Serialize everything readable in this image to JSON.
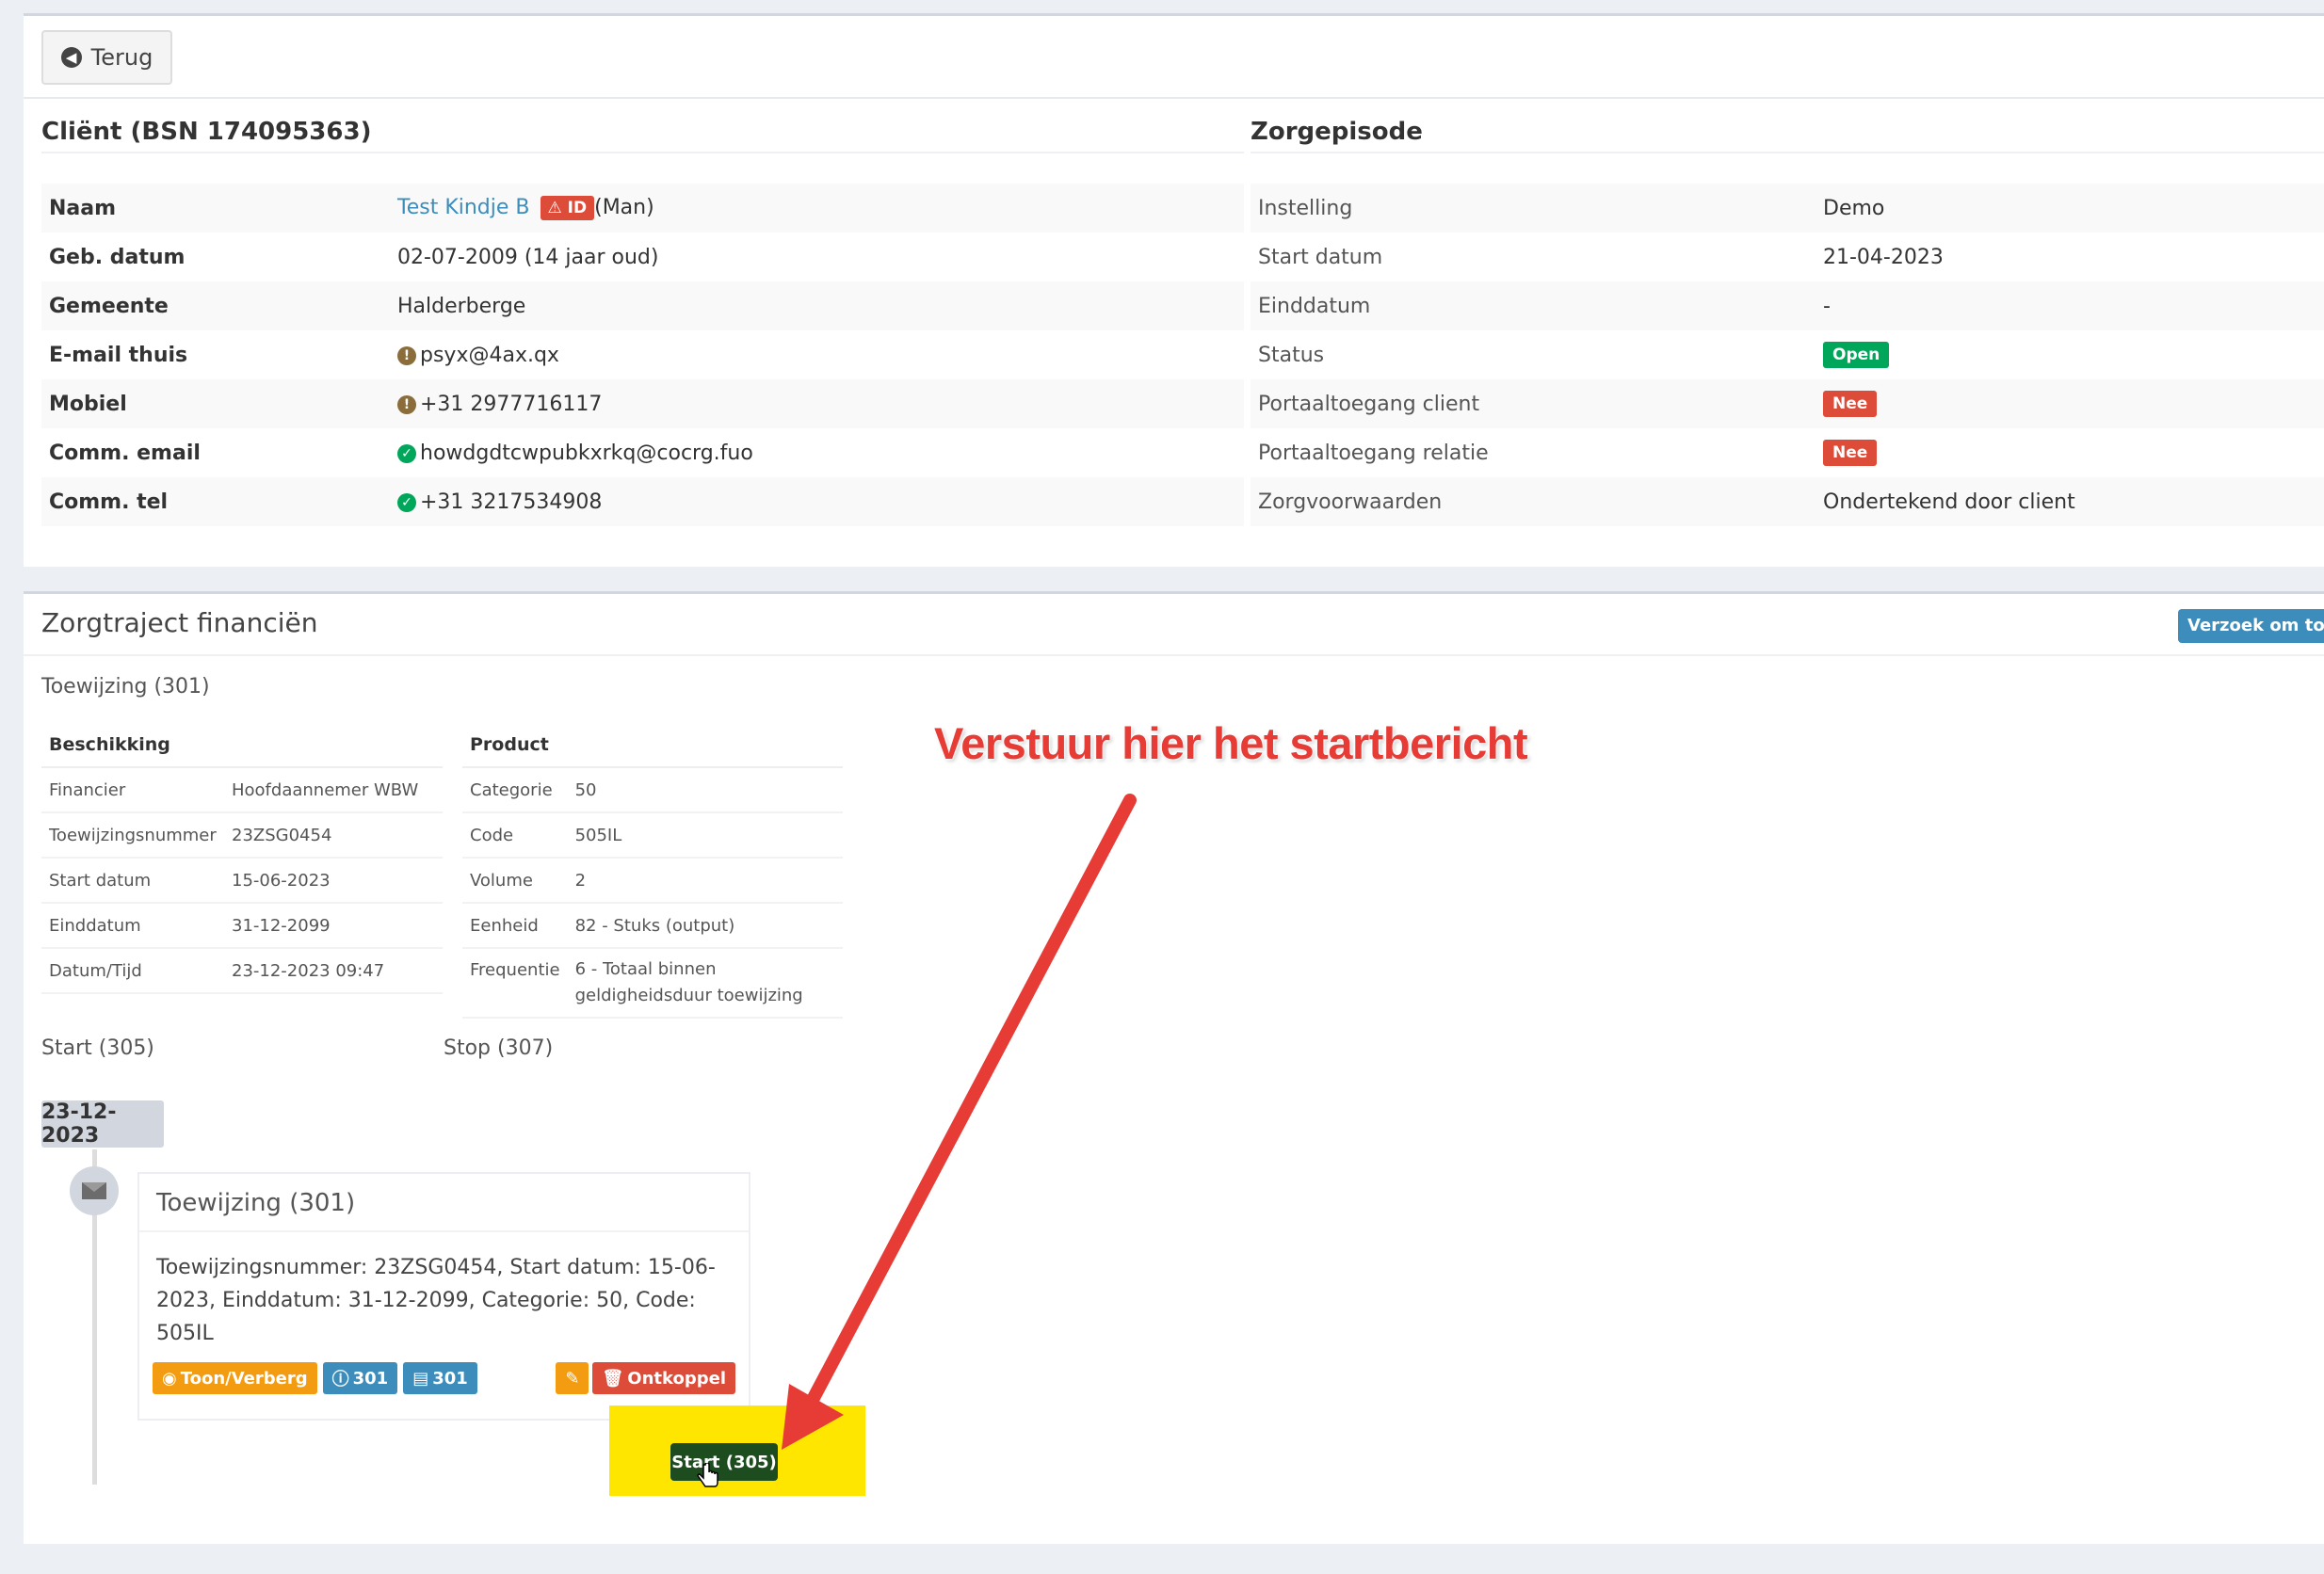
{
  "back_button": {
    "label": "Terug"
  },
  "client": {
    "title": "Cliënt (BSN 174095363)",
    "rows": [
      {
        "label": "Naam",
        "name": "Test Kindje B",
        "id_badge": "ID",
        "suffix": "(Man)"
      },
      {
        "label": "Geb. datum",
        "value": "02-07-2009 (14 jaar oud)"
      },
      {
        "label": "Gemeente",
        "value": "Halderberge"
      },
      {
        "label": "E-mail thuis",
        "value": "psyx@4ax.qx",
        "icon": "warning-icon"
      },
      {
        "label": "Mobiel",
        "value": "+31 2977716117",
        "icon": "warning-icon"
      },
      {
        "label": "Comm. email",
        "value": "howdgdtcwpubkxrkq@cocrg.fuo",
        "icon": "check-icon"
      },
      {
        "label": "Comm. tel",
        "value": "+31 3217534908",
        "icon": "check-icon"
      }
    ]
  },
  "episode": {
    "title": "Zorgepisode",
    "rows": [
      {
        "label": "Instelling",
        "value": "Demo"
      },
      {
        "label": "Start datum",
        "value": "21-04-2023"
      },
      {
        "label": "Einddatum",
        "value": "-"
      },
      {
        "label": "Status",
        "value": "Open",
        "badge": "green"
      },
      {
        "label": "Portaaltoegang client",
        "value": "Nee",
        "badge": "red"
      },
      {
        "label": "Portaaltoegang relatie",
        "value": "Nee",
        "badge": "red"
      },
      {
        "label": "Zorgvoorwaarden",
        "value": "Ondertekend door client"
      }
    ]
  },
  "financien": {
    "title": "Zorgtraject financiën",
    "request_button": "Verzoek om toev",
    "toewijzing_label": "Toewijzing (301)",
    "beschikking": {
      "header": "Beschikking",
      "rows": [
        {
          "label": "Financier",
          "value": "Hoofdaannemer WBW"
        },
        {
          "label": "Toewijzingsnummer",
          "value": "23ZSG0454"
        },
        {
          "label": "Start datum",
          "value": "15-06-2023"
        },
        {
          "label": "Einddatum",
          "value": "31-12-2099"
        },
        {
          "label": "Datum/Tijd",
          "value": "23-12-2023 09:47"
        }
      ]
    },
    "product": {
      "header": "Product",
      "rows": [
        {
          "label": "Categorie",
          "value": "50"
        },
        {
          "label": "Code",
          "value": "505IL"
        },
        {
          "label": "Volume",
          "value": "2"
        },
        {
          "label": "Eenheid",
          "value": "82 - Stuks (output)"
        },
        {
          "label": "Frequentie",
          "value": "6 - Totaal binnen geldigheidsduur toewijzing"
        }
      ]
    },
    "start_label": "Start (305)",
    "stop_label": "Stop (307)",
    "timeline": {
      "date": "23-12-2023",
      "item_title": "Toewijzing (301)",
      "item_body": "Toewijzingsnummer: 23ZSG0454, Start datum: 15-06-2023, Einddatum: 31-12-2099, Categorie: 50, Code: 505IL",
      "buttons": {
        "toggle": "Toon/Verberg",
        "info": "301",
        "pdf": "301",
        "unlink": "Ontkoppel"
      },
      "start_button": "Start (305)"
    }
  },
  "annotation": {
    "text": "Verstuur hier het startbericht",
    "color": "#e73b36"
  },
  "colors": {
    "primary": "#3c8dbc",
    "success": "#00a65a",
    "danger": "#dd4b39",
    "warning": "#f39c12",
    "highlight": "#ffe600"
  }
}
